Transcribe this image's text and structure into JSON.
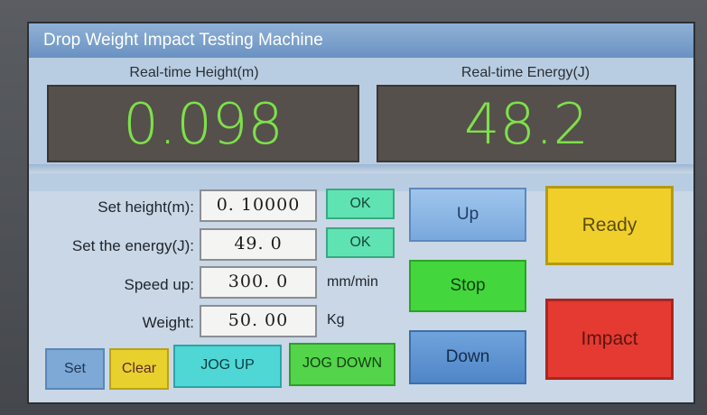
{
  "title": "Drop Weight Impact Testing Machine",
  "gauges": {
    "height_label": "Real-time Height(m)",
    "height_value": "0.098",
    "energy_label": "Real-time Energy(J)",
    "energy_value": "48.2"
  },
  "settings": {
    "set_height_label": "Set height(m):",
    "set_height_value": "0. 10000",
    "set_energy_label": "Set the energy(J):",
    "set_energy_value": "49. 0",
    "speed_label": "Speed up:",
    "speed_value": "300. 0",
    "speed_unit": "mm/min",
    "weight_label": "Weight:",
    "weight_value": "50. 00",
    "weight_unit": "Kg",
    "ok_label": "OK"
  },
  "controls": {
    "up": "Up",
    "stop": "Stop",
    "down": "Down",
    "ready": "Ready",
    "impact": "Impact"
  },
  "bottom": {
    "set": "Set",
    "clear": "Clear",
    "jog_up": "JOG UP",
    "jog_down": "JOG DOWN"
  },
  "colors": {
    "digit_green": "#7ee04a",
    "ready_yellow": "#f1cf2a",
    "impact_red": "#e43a32",
    "stop_green": "#43d63d"
  }
}
